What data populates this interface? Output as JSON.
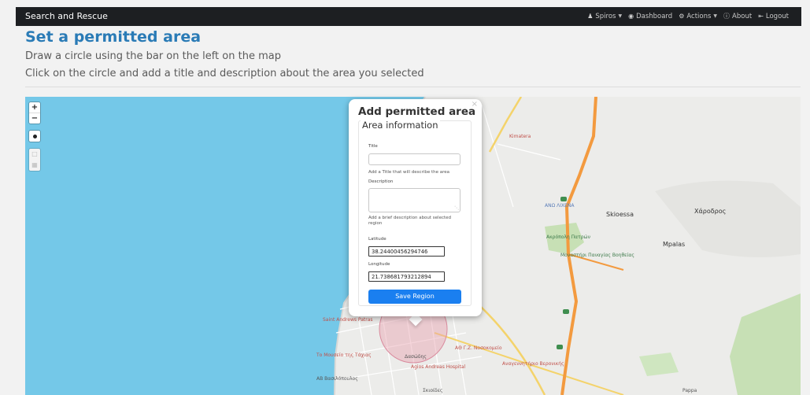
{
  "navbar": {
    "brand": "Search and Rescue",
    "user": "Spiros",
    "dashboard": "Dashboard",
    "actions": "Actions",
    "about": "About",
    "logout": "Logout"
  },
  "page": {
    "title": "Set a permitted area",
    "instruction_1": "Draw a circle using the bar on the left on the map",
    "instruction_2": "Click on the circle and add a title and description about the area you selected"
  },
  "map": {
    "zoom_in": "+",
    "zoom_out": "−",
    "labels": {
      "kimatera": "Kimatera",
      "skioessa": "Skioessa",
      "xarodros": "Χάροδρος",
      "mpalas": "Mpalas",
      "ano_lichena": "ΑΝΩ\nΛΙΧΕΝΑ",
      "akropolis": "Ακρόπολη Πατρών",
      "monastery": "Μοναστήρι Παναγίας\nΒοηθείας",
      "saint_andrews": "Saint Andrews Patras",
      "ay": "ΑΘ Γ.Ζ. Νοσοκομείο",
      "agios_andreas": "Agios Andreas Hospital",
      "dasodes": "Δασώδης",
      "anag": "Αναγεννητήριο Βερονικής",
      "ktrimaxias": "Το Μουσείο της Τάχιας",
      "ahb": "AB Βασιλόπουλος",
      "shiny": "Σκιοίδες",
      "pappa": "Pappa"
    },
    "colors": {
      "water": "#74c8e8",
      "land": "#ececea",
      "highway": "#f39a3f",
      "selection": "#e8a1b0",
      "park": "#c7e0b5"
    }
  },
  "popup": {
    "title": "Add permitted area",
    "close": "×",
    "legend": "Area information",
    "title_label": "Title",
    "title_value": "",
    "title_help": "Add a Title that will describe the area",
    "description_label": "Description",
    "description_value": "",
    "description_help": "Add a brief description about selected region",
    "latitude_label": "Latitude",
    "latitude_value": "38.24400456294746",
    "longitude_label": "Longitude",
    "longitude_value": "21.738681793212894",
    "save_button": "Save Region"
  }
}
